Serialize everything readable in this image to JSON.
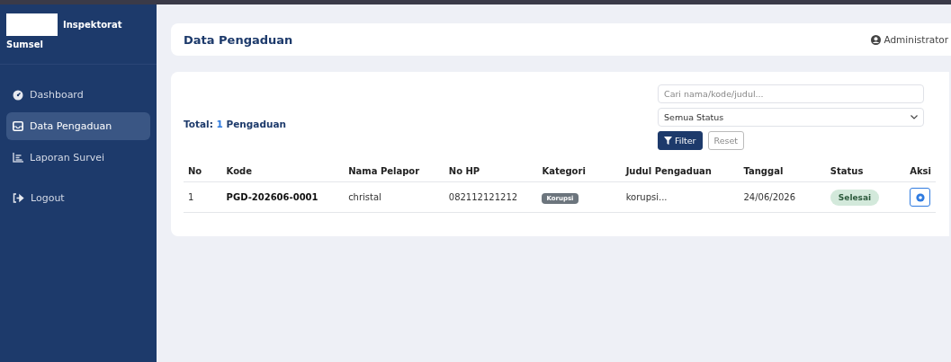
{
  "sidebar": {
    "brand": "Inspektorat",
    "brand_sub": "Sumsel",
    "items": [
      {
        "label": "Dashboard",
        "kind": "gauge",
        "selected": false
      },
      {
        "label": "Data Pengaduan",
        "kind": "inbox",
        "selected": true
      },
      {
        "label": "Laporan Survei",
        "kind": "chart",
        "selected": false
      },
      {
        "label": "Logout",
        "kind": "logout",
        "selected": false
      }
    ]
  },
  "header": {
    "title": "Data Pengaduan",
    "user": "Administrator"
  },
  "total": {
    "label": "Total:",
    "count": "1",
    "unit": "Pengaduan"
  },
  "filters": {
    "search_placeholder": "Cari nama/kode/judul...",
    "status": "Semua Status",
    "filter_button": "Filter",
    "reset_button": "Reset"
  },
  "table": {
    "columns": [
      "No",
      "Kode",
      "Nama Pelapor",
      "No HP",
      "Kategori",
      "Judul Pengaduan",
      "Tanggal",
      "Status",
      "Aksi"
    ],
    "rows": [
      {
        "no": "1",
        "kode": "PGD-202606-0001",
        "nama": "christal",
        "hp": "082112121212",
        "kategori": "Korupsi",
        "judul": "korupsi...",
        "tanggal": "24/06/2026",
        "status": "Selesai"
      }
    ]
  }
}
